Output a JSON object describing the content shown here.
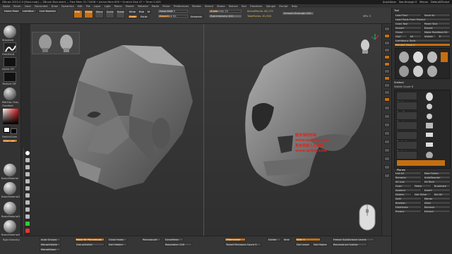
{
  "titlebar": {
    "title": "ZBrush 2022.0.5 [Maxi-mob] — ZBrush Document — Free Mem 31.734GB • Active Mem 899 • Scratch Disk 47 • Timer 0.005",
    "quicksave": "QuickSave",
    "see_through": "See-through 0",
    "menus": "Menus",
    "default_script": "DefaultZScript"
  },
  "menubar": [
    "Alpha",
    "Brush",
    "Color",
    "Document",
    "Draw",
    "Dynamics",
    "Edit",
    "File",
    "Layer",
    "Light",
    "Macro",
    "Marker",
    "Material",
    "Movie",
    "Picker",
    "Preferences",
    "Render",
    "Stencil",
    "Stroke",
    "Texture",
    "Tool",
    "Transform",
    "Zplugin",
    "Zscript",
    "Help"
  ],
  "toolbar": {
    "home_page": "Home Page",
    "lightbox": "LightBox",
    "live_boolean": "Live Boolean",
    "edit": "Edit",
    "draw": "Draw",
    "move": "Move",
    "scale": "Scale",
    "rotate": "Rotate",
    "mrgb": "Mrgb",
    "rgb": "Rgb",
    "m": "M",
    "zadd": "Zadd",
    "zsub": "Zsub",
    "focal_shift": "Focal Shift 0",
    "draw_size": "Draw Size 64",
    "z_intensity": "Z Intensity 25",
    "rgb_intensity": "Rgb Intensity 100",
    "dynamic": "Dynamic",
    "activepoints": "ActivePoints: 80,170",
    "totalpoints": "TotalPoints: 81,900",
    "smooth_strength": "Smooth Strength 100",
    "spix": "SPix 3"
  },
  "leftshelf": {
    "brush_label": "Standard",
    "stroke_label": "FreeHand",
    "alpha_label": "Alpha Off",
    "texture_label": "Texture Off",
    "material_label": "MatCap Gray",
    "gradient": "Gradient",
    "switch_color": "SwitchColor",
    "alternate": "Alternate",
    "basic_materials": [
      "BasicMaterial",
      "BasicMaterial2",
      "BasicMaterial3",
      "BasicMaterial4"
    ]
  },
  "viewport": {
    "watermark": [
      "脱多浑的形础",
      "www.ppfang.com",
      "更多优质人工视频",
      "www.qnbig.com"
    ]
  },
  "righttools": [
    "Bpr",
    "SPix 3",
    "Scroll",
    "Zoom",
    "Actual",
    "AAHalf",
    "Persp",
    "Floor",
    "Local",
    "LSym",
    "Xyz",
    "Frame",
    "Move",
    "ZoomD",
    "Rotate",
    "PolyF",
    "Transp",
    "Ghost",
    "Solo",
    "Xpose"
  ],
  "rightpanel": {
    "header": "Tool",
    "load_tool": "Load Tool",
    "save_as": "Save As",
    "load_tools_project": "Load Tools From Project",
    "copy_tool": "Copy Tool",
    "paste_tool": "Paste Tool",
    "import": "Import",
    "export": "Export",
    "clone": "Clone",
    "make_polymesh": "Make PolyMesh3D",
    "goz": "GoZ",
    "all": "All",
    "visible": "Visible",
    "r": "R",
    "lightbox_tools": "Lightbox ▸ Tools",
    "current_tool": "Merged_Base 0",
    "subtool": "Subtool",
    "visible_count": "Visible Count 8",
    "subtools": [
      "Skull",
      "Eye_R",
      "Eye_L",
      "Jaw",
      "Teeth_Up",
      "Teeth_Lo",
      "Head",
      "Planes"
    ],
    "list_all": "List All",
    "new_folder": "New Folder",
    "rename": "Rename",
    "auto_reorder": "AutoReorder",
    "all_low": "All Low",
    "all_high": "All High",
    "copy": "Copy",
    "paste": "Paste",
    "duplicate": "Duplicate",
    "append": "Append",
    "insert": "Insert",
    "delete": "Delete",
    "del_other": "Del Other",
    "del_all": "Del All",
    "split": "Split",
    "merge": "Merge",
    "boolean": "Boolean",
    "align": "Align",
    "distribute": "Distribute",
    "remesh": "Remesh",
    "project": "Project",
    "extract": "Extract"
  },
  "bottombar": {
    "rgb_intensity": "Rgb Intensity",
    "auto_groups": "Auto Groups",
    "merge_visible": "MergeVisible",
    "merge_down": "MergeDown",
    "mask_by_polygroups": "Mask By Polygroups",
    "group_visible": "GroupVisible",
    "close_holes": "Close Holes",
    "del_hidden": "Del Hidden",
    "polygroup_it": "PolygroupIt",
    "dynamesh": "DynaMesh",
    "resolution": "Resolution 128",
    "zremesher": "ZRemesher",
    "target_polys": "Target Polygons Count 5",
    "divide": "Divide",
    "smt": "Smt",
    "sdiv": "SDiv 1",
    "del_lower": "Del Lower",
    "del_higher": "Del Higher",
    "freeze": "Freeze SubDivision Levels",
    "reconstruct": "Reconstruct Subdiv"
  }
}
